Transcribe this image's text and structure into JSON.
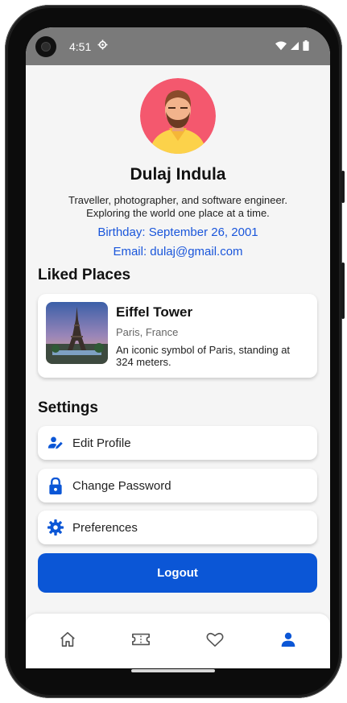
{
  "status_bar": {
    "time": "4:51"
  },
  "profile": {
    "name": "Dulaj Indula",
    "bio_line1": "Traveller, photographer, and software engineer.",
    "bio_line2": "Exploring the world one place at a time.",
    "birthday": "Birthday: September 26, 2001",
    "email": "Email: dulaj@gmail.com"
  },
  "liked_places": {
    "title": "Liked Places",
    "items": [
      {
        "name": "Eiffel Tower",
        "location": "Paris, France",
        "description": "An iconic symbol of Paris, standing at 324 meters."
      }
    ]
  },
  "settings": {
    "title": "Settings",
    "items": [
      {
        "label": "Edit Profile",
        "icon": "edit-profile-icon"
      },
      {
        "label": "Change Password",
        "icon": "lock-icon"
      },
      {
        "label": "Preferences",
        "icon": "gear-icon"
      }
    ]
  },
  "logout_label": "Logout",
  "bottom_nav": [
    {
      "icon": "home-icon",
      "active": false
    },
    {
      "icon": "ticket-icon",
      "active": false
    },
    {
      "icon": "heart-icon",
      "active": false
    },
    {
      "icon": "person-icon",
      "active": true
    }
  ],
  "colors": {
    "accent": "#0b56d6",
    "link": "#1a56db",
    "status_bar": "#7a7a7a",
    "background": "#f5f5f5",
    "nav_inactive": "#555555"
  }
}
